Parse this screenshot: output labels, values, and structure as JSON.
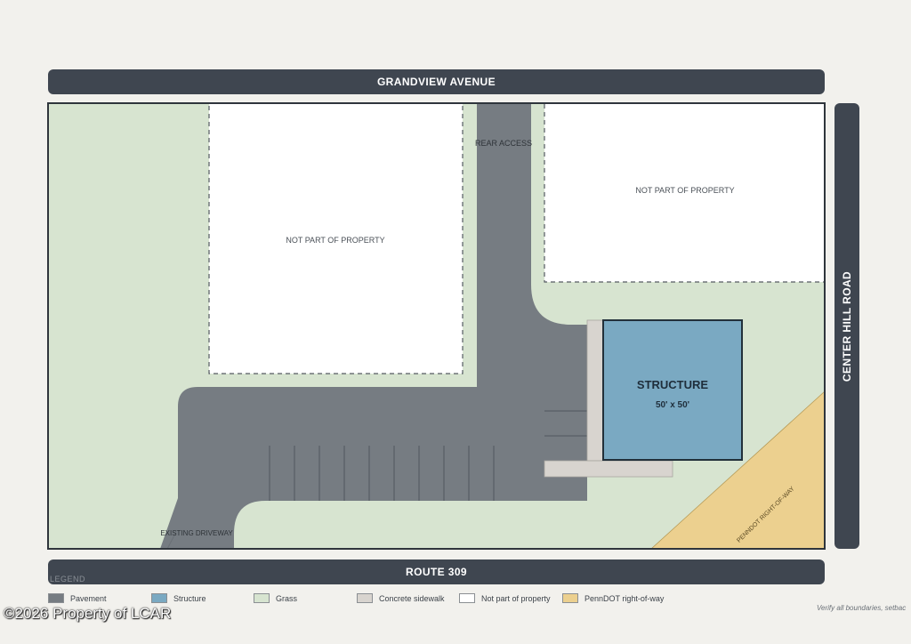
{
  "roads": {
    "north": "GRANDVIEW AVENUE",
    "south": "ROUTE 309",
    "east": "CENTER HILL ROAD"
  },
  "areas": {
    "not_part_left": "NOT PART OF PROPERTY",
    "not_part_right": "NOT PART OF PROPERTY",
    "rear_access": "REAR ACCESS",
    "existing_driveway": "EXISTING DRIVEWAY",
    "penndot": "PENNDOT RIGHT-OF-WAY"
  },
  "structure": {
    "title": "STRUCTURE",
    "dimensions": "50' x 50'"
  },
  "legend": {
    "title": "LEGEND",
    "items": [
      {
        "label": "Pavement",
        "color": "#767c82"
      },
      {
        "label": "Structure",
        "color": "#7aa9c2"
      },
      {
        "label": "Grass",
        "color": "#d7e4d0"
      },
      {
        "label": "Concrete sidewalk",
        "color": "#d8d4cf"
      },
      {
        "label": "Not part of property",
        "color": "#ffffff"
      },
      {
        "label": "PennDOT right-of-way",
        "color": "#ecd08f"
      }
    ]
  },
  "note": "Verify all boundaries, setbac",
  "copyright": "©2026 Property of LCAR",
  "colors": {
    "road": "#3f4650",
    "pavement": "#767c82",
    "grass": "#d7e4d0",
    "structure": "#7aa9c2",
    "sidewalk": "#d8d4cf",
    "penndot": "#ecd08f",
    "outline": "#2f353c"
  }
}
